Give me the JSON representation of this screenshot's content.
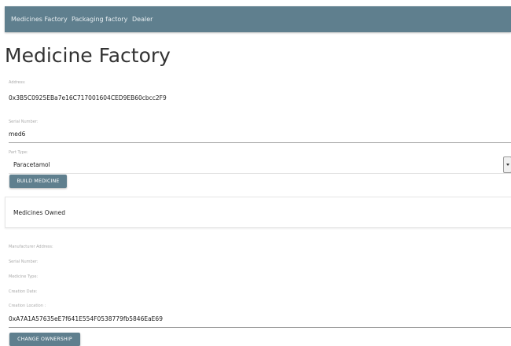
{
  "nav": {
    "items": [
      {
        "label": "Medicines Factory"
      },
      {
        "label": "Packaging factory"
      },
      {
        "label": "Dealer"
      }
    ]
  },
  "page": {
    "title": "Medicine Factory"
  },
  "address": {
    "label": "Address:",
    "value": "0x3B5C0925EBa7e16C717001604CED9EB60cbcc2F9"
  },
  "serial": {
    "label": "Serial Number:",
    "value": "med6"
  },
  "part_type": {
    "label": "Part Type:",
    "selected": "Paracetamol"
  },
  "build_button": {
    "label": "Build Medicine"
  },
  "owned_card": {
    "title": "Medicines Owned"
  },
  "details": {
    "manufacturer_label": "Manufacturer Address:",
    "serial_label": "Serial Number:",
    "type_label": "Medicine Type:",
    "date_label": "Creation Date:",
    "location_label": "Creation Location :"
  },
  "new_owner": {
    "value": "0xA7A1A57635eE7f641E554F0538779fb5846EaE69"
  },
  "change_button": {
    "label": "Change Ownership"
  },
  "colors": {
    "nav_bg": "#5f7f8e",
    "button_bg": "#5f7f8e"
  }
}
